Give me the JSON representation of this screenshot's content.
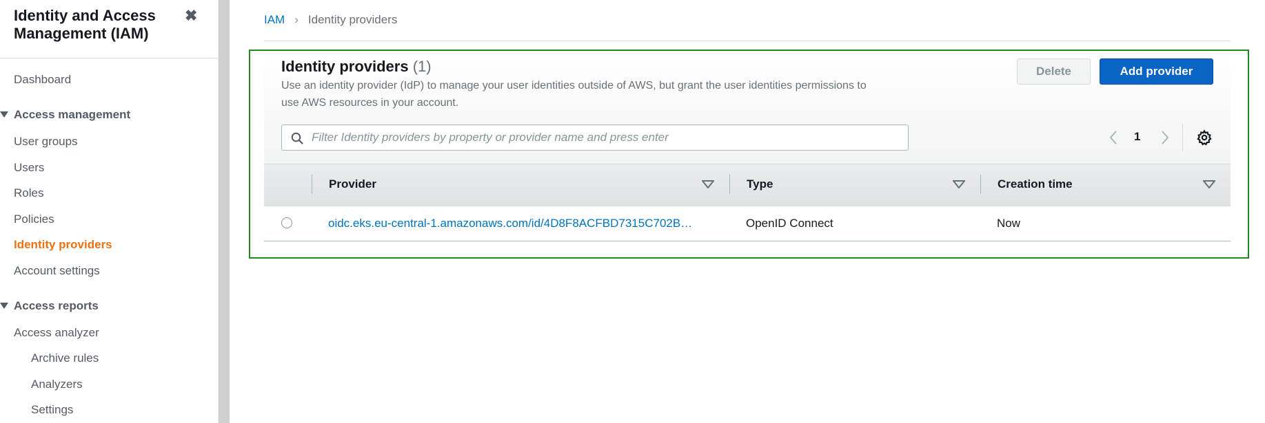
{
  "sidebar": {
    "title": "Identity and Access Management (IAM)",
    "close_icon": "close-icon",
    "items": [
      {
        "label": "Dashboard"
      },
      {
        "label": "Access management",
        "section": true
      },
      {
        "label": "User groups"
      },
      {
        "label": "Users"
      },
      {
        "label": "Roles"
      },
      {
        "label": "Policies"
      },
      {
        "label": "Identity providers",
        "active": true
      },
      {
        "label": "Account settings"
      },
      {
        "label": "Access reports",
        "section": true
      },
      {
        "label": "Access analyzer"
      },
      {
        "label": "Archive rules"
      },
      {
        "label": "Analyzers"
      },
      {
        "label": "Settings"
      }
    ]
  },
  "breadcrumb": {
    "root": "IAM",
    "current": "Identity providers"
  },
  "panel": {
    "title": "Identity providers",
    "count": "(1)",
    "description": "Use an identity provider (IdP) to manage your user identities outside of AWS, but grant the user identities permissions to use AWS resources in your account.",
    "delete_label": "Delete",
    "add_label": "Add provider",
    "search_placeholder": "Filter Identity providers by property or provider name and press enter",
    "page_number": "1"
  },
  "table": {
    "columns": [
      "Provider",
      "Type",
      "Creation time"
    ],
    "rows": [
      {
        "provider": "oidc.eks.eu-central-1.amazonaws.com/id/4D8F8ACFBD7315C702B…",
        "type": "OpenID Connect",
        "creation_time": "Now"
      }
    ]
  },
  "colors": {
    "accent_active": "#ec7211",
    "link": "#0073bb",
    "primary_button": "#0a64c4",
    "panel_outline": "#1e8a1e"
  }
}
